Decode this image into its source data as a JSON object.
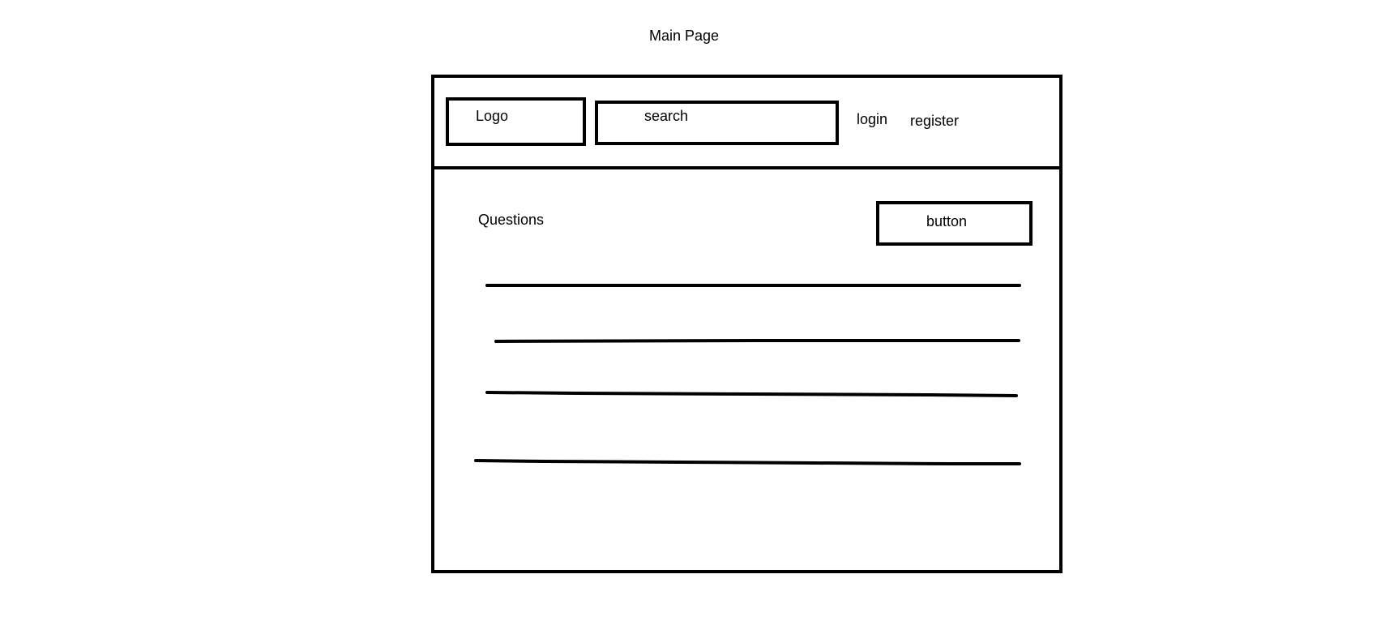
{
  "page": {
    "title": "Main Page"
  },
  "header": {
    "logo_label": "Logo",
    "search_label": "search",
    "login_label": "login",
    "register_label": "register"
  },
  "main": {
    "section_title": "Questions",
    "button_label": "button"
  },
  "placeholders": {
    "question_line_count": 4
  },
  "colors": {
    "stroke": "#000000",
    "background": "#ffffff"
  }
}
